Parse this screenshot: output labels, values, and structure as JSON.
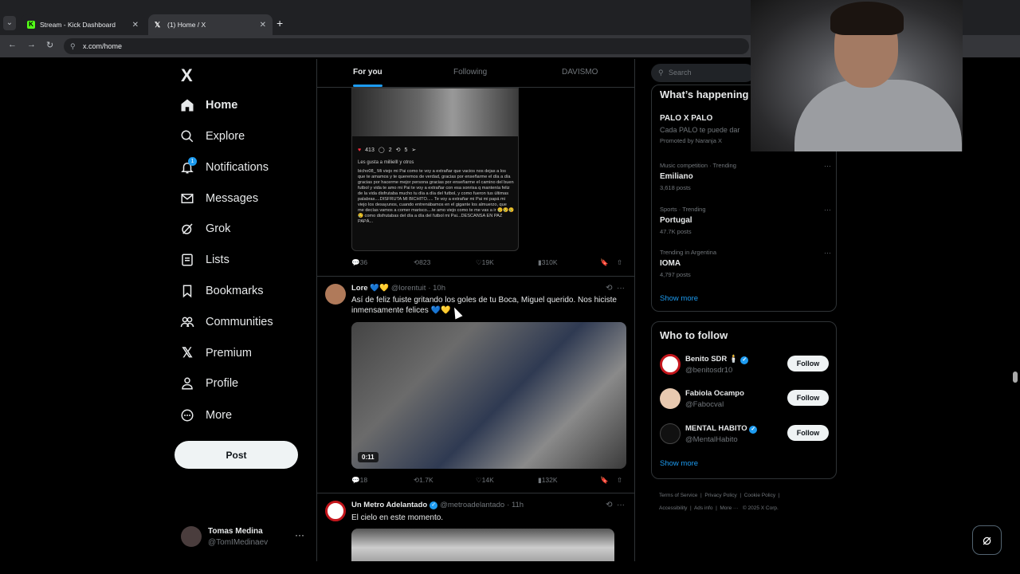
{
  "browser": {
    "tabs": [
      {
        "title": "Stream - Kick Dashboard"
      },
      {
        "title": "(1) Home / X"
      }
    ],
    "url": "x.com/home"
  },
  "sidebar": {
    "logo": "X",
    "items": [
      {
        "label": "Home",
        "icon": "home-icon"
      },
      {
        "label": "Explore",
        "icon": "search-icon"
      },
      {
        "label": "Notifications",
        "icon": "bell-icon",
        "badge": "1"
      },
      {
        "label": "Messages",
        "icon": "envelope-icon"
      },
      {
        "label": "Grok",
        "icon": "grok-icon"
      },
      {
        "label": "Lists",
        "icon": "list-icon"
      },
      {
        "label": "Bookmarks",
        "icon": "bookmark-icon"
      },
      {
        "label": "Communities",
        "icon": "people-icon"
      },
      {
        "label": "Premium",
        "icon": "x-icon"
      },
      {
        "label": "Profile",
        "icon": "person-icon"
      },
      {
        "label": "More",
        "icon": "more-circle-icon"
      }
    ],
    "post_label": "Post",
    "account": {
      "name": "Tomas Medina",
      "handle": "@TomIMedinaev"
    }
  },
  "feed": {
    "tabs": [
      "For you",
      "Following",
      "DAVISMO"
    ],
    "embedded_post": {
      "likes": "413",
      "comments": "2",
      "reposts": "5",
      "liked_by": "Les gusta a milliellI y otros",
      "caption": "bicho08_ Mi viejo mi Pai como te voy a extrañar que vacios nos dejas a los que te amamos y te queremos de verdad, gracias por enseñarme el día a día gracias por hacerme mejor persona gracias por enseñarme el camino del buen futbol y vida te amo mi Pai te voy a extrañar con esa sonrisa q mantenía feliz de la vida disfrutaba mucho tu día a día del futbol, y como fueron tus últimas palabras....DISFRUTA MI BICHITO..... Te voy a extrañar mi Pai mi papá mi viejo los desayunos, cuando entrenábamos en el gigante los almuerzo, que me decías vamos a comer marisco....te amo viejo como te me vas a ir 😢😢😢😢 como disfrutabas del día a día del futbol mi Pai...DESCANSA EN PAZ PAPÁ..."
    },
    "first_actions": {
      "replies": "36",
      "reposts": "823",
      "likes": "19K",
      "views": "310K"
    },
    "tweets": [
      {
        "name": "Lore 💙💛",
        "handle": "@lorentuit",
        "time": "· 10h",
        "text": "Así de feliz fuiste gritando los goles de tu Boca, Miguel querido. Nos hiciste inmensamente felices 💙💛",
        "video_duration": "0:11",
        "replies": "18",
        "reposts": "1.7K",
        "likes": "14K",
        "views": "132K"
      },
      {
        "name": "Un Metro Adelantado",
        "handle": "@metroadelantado",
        "time": "· 11h",
        "text": "El cielo en este momento."
      }
    ]
  },
  "right": {
    "search_placeholder": "Search",
    "trends_title": "What’s happening",
    "promo": {
      "title": "PALO X PALO",
      "desc": "Cada PALO te puede dar",
      "promoted": "Promoted by Naranja X"
    },
    "trends": [
      {
        "context": "Music competition · Trending",
        "topic": "Emiliano",
        "posts": "3,618 posts"
      },
      {
        "context": "Sports · Trending",
        "topic": "Portugal",
        "posts": "47.7K posts"
      },
      {
        "context": "Trending in Argentina",
        "topic": "IOMA",
        "posts": "4,797 posts"
      }
    ],
    "show_more": "Show more",
    "who_title": "Who to follow",
    "who": [
      {
        "name": "Benito SDR 🕯️",
        "handle": "@benitosdr10",
        "follow": "Follow"
      },
      {
        "name": "Fabiola Ocampo",
        "handle": "@Fabocval",
        "follow": "Follow"
      },
      {
        "name": "MENTAL HABITO",
        "handle": "@MentalHabito",
        "follow": "Follow"
      }
    ],
    "footer": [
      "Terms of Service",
      "Privacy Policy",
      "Cookie Policy",
      "Accessibility",
      "Ads info",
      "More ···",
      "© 2025 X Corp."
    ]
  },
  "colors": {
    "accent": "#1d9bf0",
    "bg": "#000000",
    "text": "#e7e9ea",
    "muted": "#71767b"
  }
}
